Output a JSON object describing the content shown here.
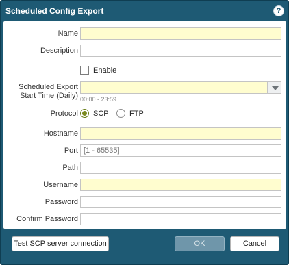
{
  "dialog": {
    "title": "Scheduled Config Export",
    "help_label": "?"
  },
  "form": {
    "name_label": "Name",
    "name_value": "",
    "description_label": "Description",
    "description_value": "",
    "enable_label": "Enable",
    "enable_checked": false,
    "start_time_label_line1": "Scheduled Export",
    "start_time_label_line2": "Start Time (Daily)",
    "start_time_value": "",
    "start_time_hint": "00:00 - 23:59",
    "protocol_label": "Protocol",
    "protocol_options": [
      "SCP",
      "FTP"
    ],
    "protocol_selected": "SCP",
    "hostname_label": "Hostname",
    "hostname_value": "",
    "port_label": "Port",
    "port_placeholder": "[1 - 65535]",
    "path_label": "Path",
    "path_value": "",
    "username_label": "Username",
    "username_value": "",
    "password_label": "Password",
    "confirm_password_label": "Confirm Password"
  },
  "footer": {
    "test_button": "Test SCP server connection",
    "ok_button": "OK",
    "cancel_button": "Cancel"
  },
  "colors": {
    "title_bar": "#1e5a74",
    "required_field": "#fffdcf",
    "radio_selected": "#7a8a1e",
    "ok_disabled": "#6f96aa"
  }
}
